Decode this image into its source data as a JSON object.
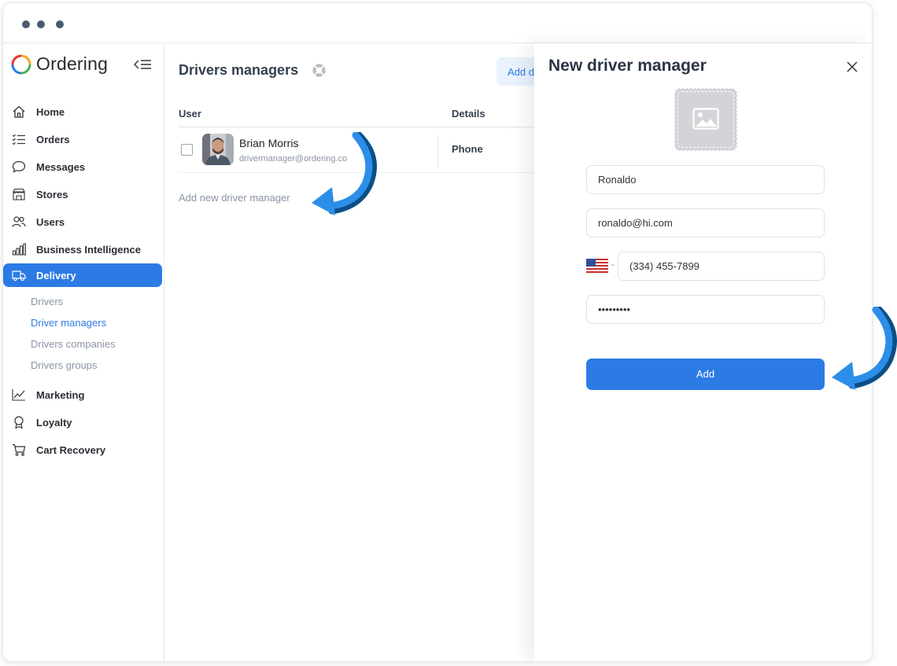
{
  "window": {
    "dots": [
      "dot",
      "dot",
      "dot"
    ]
  },
  "sidebar": {
    "brand": "Ordering",
    "items": [
      {
        "label": "Home",
        "icon": "home-icon"
      },
      {
        "label": "Orders",
        "icon": "list-icon"
      },
      {
        "label": "Messages",
        "icon": "chat-icon"
      },
      {
        "label": "Stores",
        "icon": "shop-icon"
      },
      {
        "label": "Users",
        "icon": "users-icon"
      },
      {
        "label": "Business Intelligence",
        "icon": "bar-chart-icon"
      },
      {
        "label": "Delivery",
        "icon": "truck-icon",
        "active": true
      },
      {
        "label": "Marketing",
        "icon": "trend-icon"
      },
      {
        "label": "Loyalty",
        "icon": "award-icon"
      },
      {
        "label": "Cart Recovery",
        "icon": "cart-icon"
      }
    ],
    "delivery_sub": [
      {
        "label": "Drivers"
      },
      {
        "label": "Driver managers",
        "active": true
      },
      {
        "label": "Drivers companies"
      },
      {
        "label": "Drivers groups"
      }
    ]
  },
  "main": {
    "title": "Drivers managers",
    "add_button": "Add d",
    "columns": {
      "user": "User",
      "details": "Details"
    },
    "rows": [
      {
        "name": "Brian Morris",
        "email": "drivermanager@ordering.co",
        "details": "Phone"
      }
    ],
    "add_link": "Add new driver manager"
  },
  "panel": {
    "title": "New driver manager",
    "fields": {
      "name": "Ronaldo",
      "email": "ronaldo@hi.com",
      "phone": "(334) 455-7899",
      "password": "•••••••••"
    },
    "submit": "Add"
  },
  "colors": {
    "accent": "#2c7be5",
    "arrow": "#2c8ee8",
    "arrow_dark": "#0b4f86"
  }
}
